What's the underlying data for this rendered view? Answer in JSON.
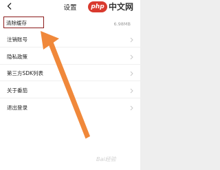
{
  "header": {
    "title": "设置",
    "back_icon": "chevron-left-icon"
  },
  "watermark": {
    "logo_text": "php",
    "text": "中文网"
  },
  "rows": [
    {
      "label": "清除缓存",
      "value": "6.98MB"
    },
    {
      "label": "注销账号"
    },
    {
      "label": "隐私政策"
    },
    {
      "label": "第三方SDK列表"
    },
    {
      "label": "关于番茄"
    },
    {
      "label": "退出登录"
    }
  ],
  "annotation": {
    "arrow_color": "#f0883a",
    "highlight_color": "#8b1a1a"
  },
  "bottom_watermark": "Bai经验"
}
